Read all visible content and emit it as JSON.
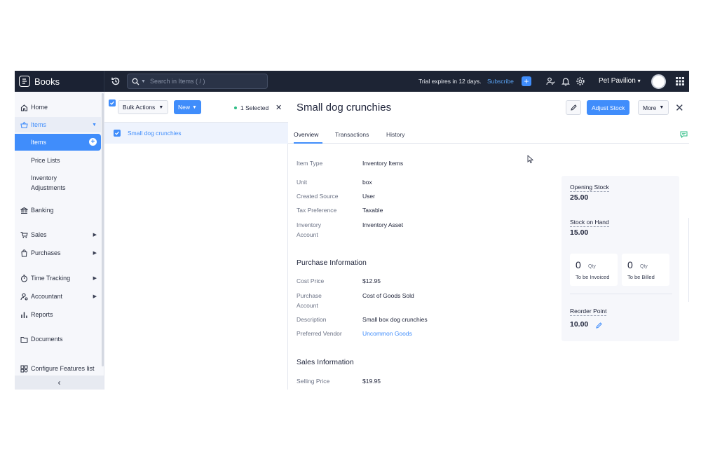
{
  "app": {
    "name": "Books"
  },
  "topbar": {
    "search_placeholder": "Search in Items ( / )",
    "trial_text": "Trial expires in 12 days.",
    "subscribe_label": "Subscribe",
    "org_name": "Pet Pavilion",
    "org_caret": "▾",
    "plus_label": "+"
  },
  "sidebar": {
    "home": "Home",
    "items": "Items",
    "items_sub": {
      "items": "Items",
      "price_lists": "Price Lists",
      "inventory_adjustments_1": "Inventory",
      "inventory_adjustments_2": "Adjustments"
    },
    "banking": "Banking",
    "sales": "Sales",
    "purchases": "Purchases",
    "time_tracking": "Time Tracking",
    "accountant": "Accountant",
    "reports": "Reports",
    "documents": "Documents",
    "configure": "Configure Features list",
    "arrow_right": "▶",
    "arrow_down": "▼",
    "add": "+",
    "collapse": "‹"
  },
  "list": {
    "bulk_actions": "Bulk Actions",
    "new_label": "New",
    "selected_text": "1 Selected",
    "close": "✕",
    "rows": [
      {
        "name": "Small dog crunchies",
        "checked": true
      }
    ]
  },
  "detail": {
    "title": "Small dog crunchies",
    "adjust_stock": "Adjust Stock",
    "more": "More",
    "close": "✕",
    "tabs": [
      "Overview",
      "Transactions",
      "History"
    ],
    "fields": {
      "item_type": {
        "label": "Item Type",
        "value": "Inventory Items"
      },
      "unit": {
        "label": "Unit",
        "value": "box"
      },
      "created_source": {
        "label": "Created Source",
        "value": "User"
      },
      "tax_preference": {
        "label": "Tax Preference",
        "value": "Taxable"
      },
      "inventory_account": {
        "label_1": "Inventory",
        "label_2": "Account",
        "value": "Inventory Asset"
      }
    },
    "purchase": {
      "heading": "Purchase Information",
      "cost_price": {
        "label": "Cost Price",
        "value": "$12.95"
      },
      "purchase_account": {
        "label_1": "Purchase",
        "label_2": "Account",
        "value": "Cost of Goods Sold"
      },
      "description": {
        "label": "Description",
        "value": "Small box dog crunchies"
      },
      "preferred_vendor": {
        "label": "Preferred Vendor",
        "value": "Uncommon Goods"
      }
    },
    "sales": {
      "heading": "Sales Information",
      "selling_price": {
        "label": "Selling Price",
        "value": "$19.95"
      }
    },
    "stock": {
      "opening_stock_label": "Opening Stock",
      "opening_stock_value": "25.00",
      "stock_on_hand_label": "Stock on Hand",
      "stock_on_hand_value": "15.00",
      "to_be_invoiced": {
        "qty": "0",
        "unit": "Qty",
        "label": "To be Invoiced"
      },
      "to_be_billed": {
        "qty": "0",
        "unit": "Qty",
        "label": "To be Billed"
      },
      "reorder_point_label": "Reorder Point",
      "reorder_point_value": "10.00"
    }
  },
  "colors": {
    "accent": "#408dfb",
    "topbar": "#1d2434",
    "sidebar": "#f6f7fb",
    "link": "#408dfb"
  }
}
